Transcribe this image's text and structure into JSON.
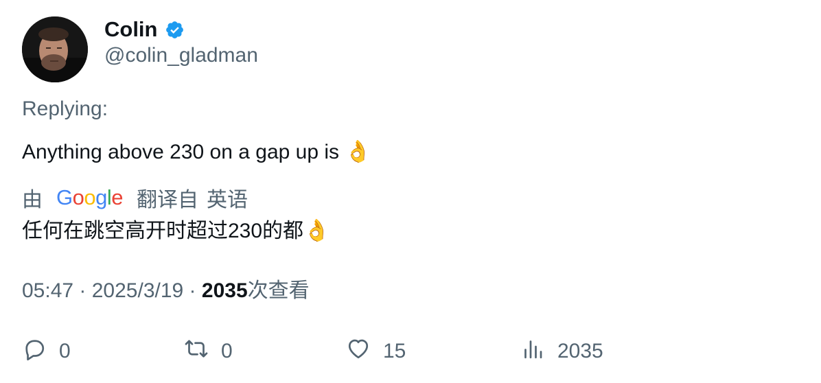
{
  "author": {
    "display_name": "Colin",
    "handle": "@colin_gladman",
    "verified_icon": "verified-badge-icon",
    "verified_color": "#1d9bf0"
  },
  "tweet": {
    "replying_label": "Replying:",
    "text": "Anything above 230 on a gap up is",
    "text_emoji": "👌"
  },
  "translation": {
    "prefix": "由",
    "provider": "Google",
    "translated_from": "翻译自",
    "language": "英语",
    "text": "任何在跳空高开时超过230的都",
    "text_emoji": "👌",
    "google_colors": [
      "#4285F4",
      "#EA4335",
      "#FBBC05",
      "#4285F4",
      "#34A853",
      "#EA4335"
    ]
  },
  "meta": {
    "time": "05:47",
    "separator": " · ",
    "date": "2025/3/19",
    "views_count": "2035",
    "views_label": "次查看"
  },
  "actions": {
    "reply": {
      "icon": "reply-icon",
      "count": "0"
    },
    "retweet": {
      "icon": "retweet-icon",
      "count": "0"
    },
    "like": {
      "icon": "heart-icon",
      "count": "15"
    },
    "views": {
      "icon": "analytics-icon",
      "count": "2035"
    }
  },
  "colors": {
    "text_primary": "#0f1419",
    "text_secondary": "#536471",
    "verified": "#1d9bf0"
  }
}
